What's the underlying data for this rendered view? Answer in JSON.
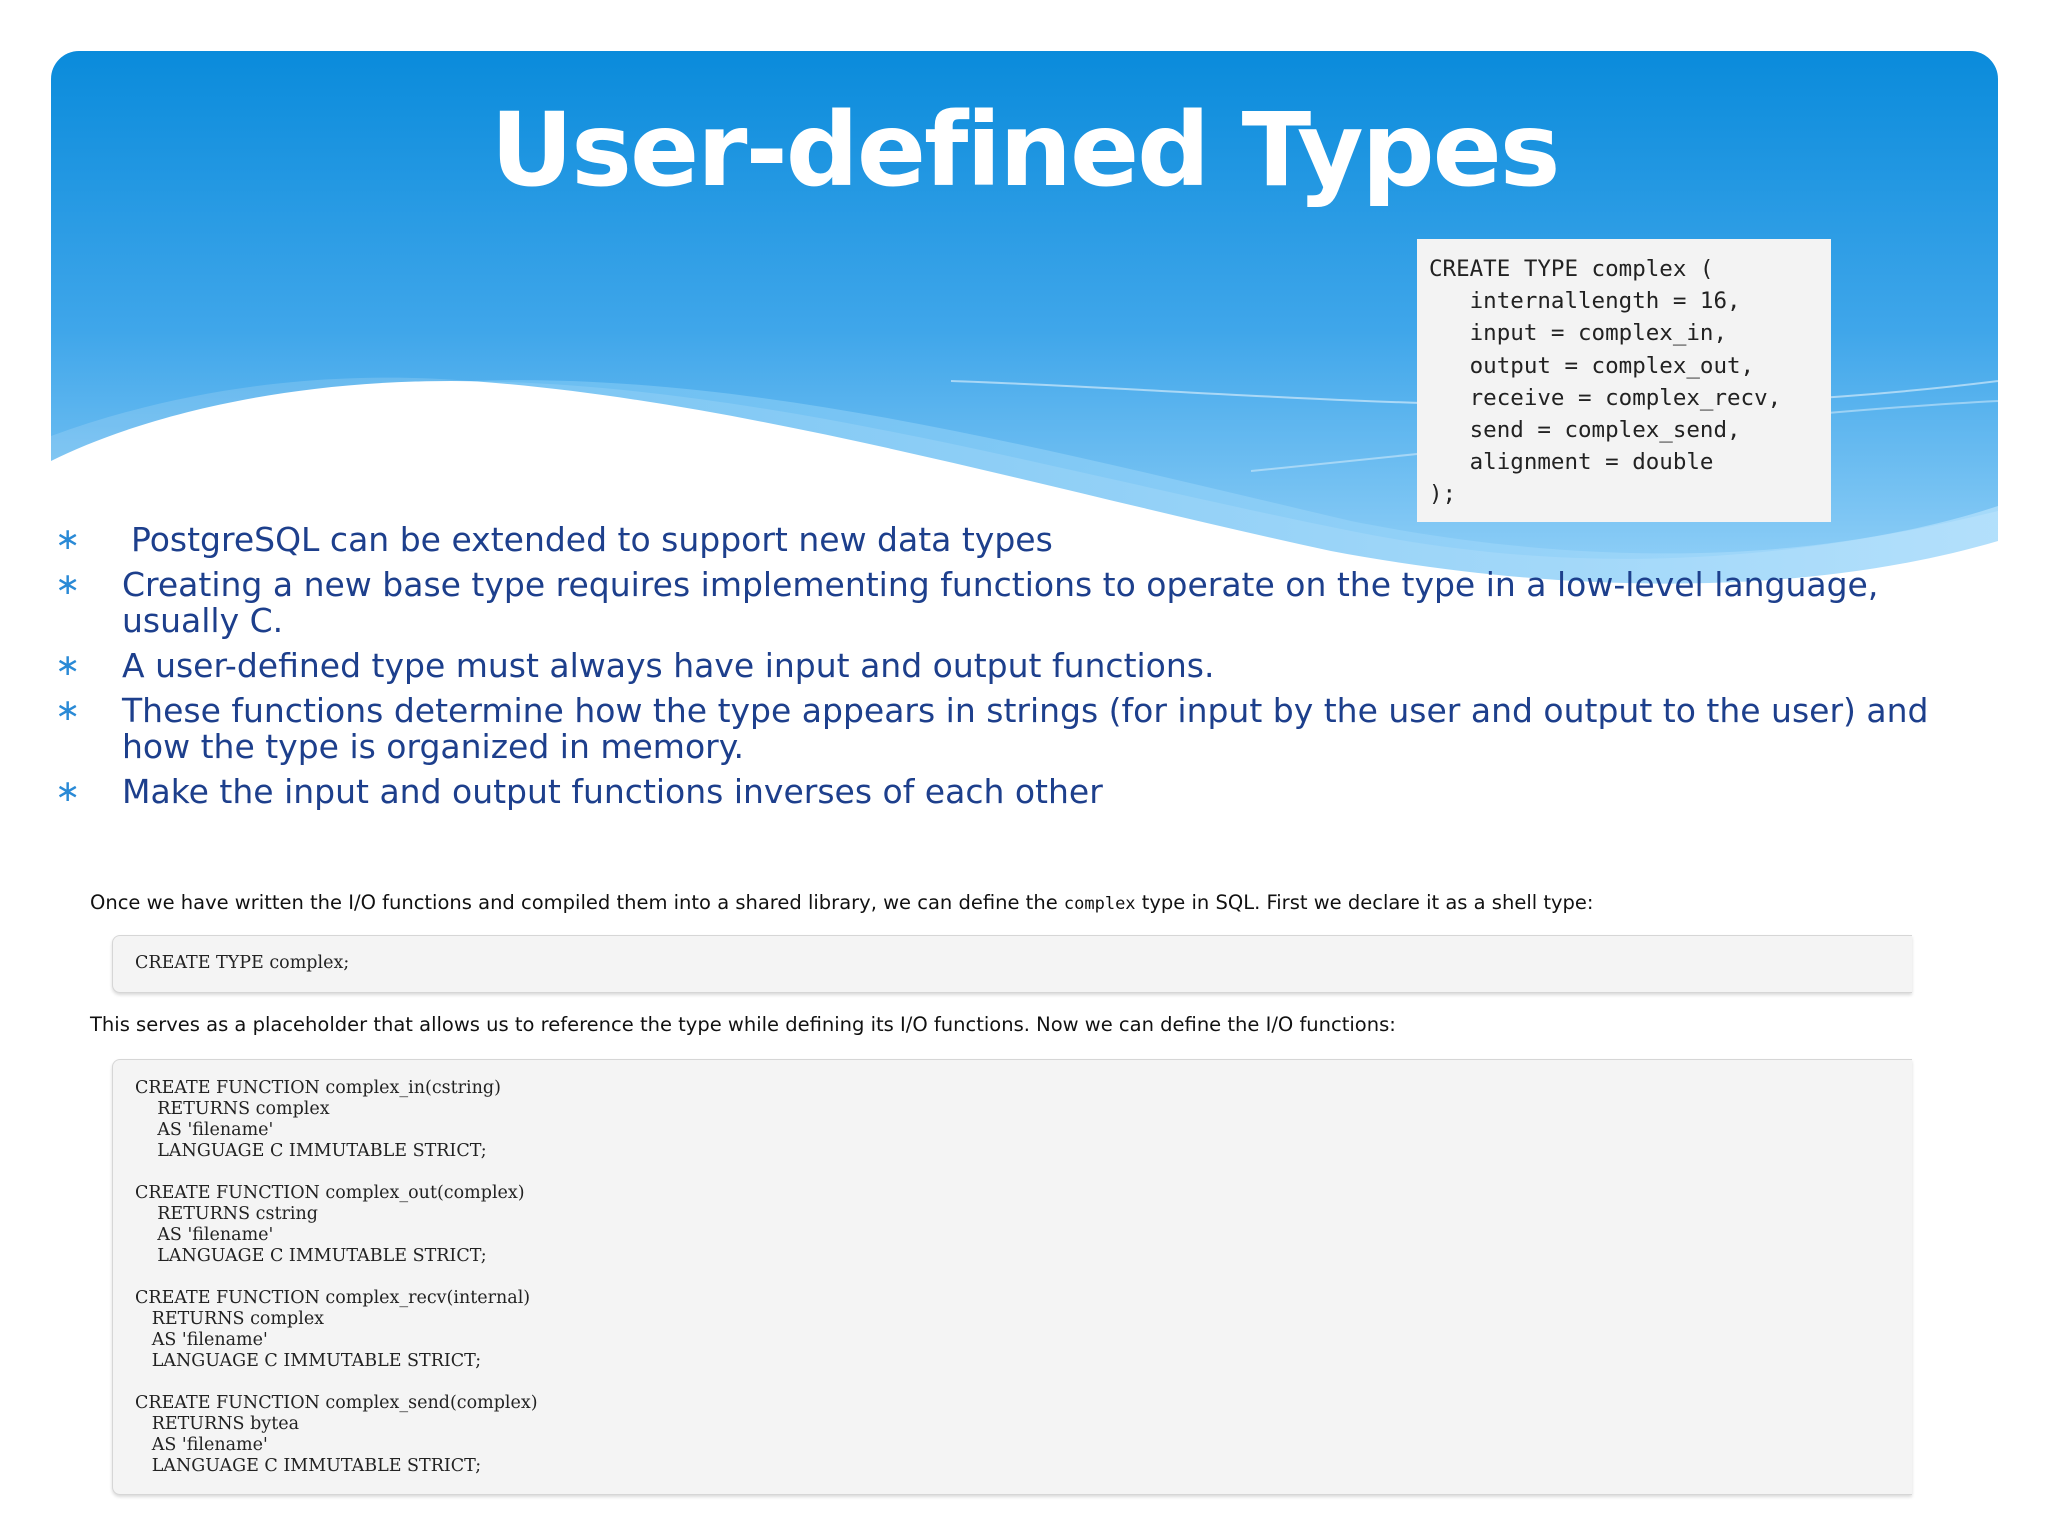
{
  "slide": {
    "title": "User-defined Types",
    "colors": {
      "title": "#ffffff",
      "bullet_text": "#1d3f8c",
      "bullet_marker": "#2a8ad6",
      "header_top": "#0b8fdc"
    }
  },
  "snippet": {
    "lines": [
      "CREATE TYPE complex (",
      "   internallength = 16,",
      "   input = complex_in,",
      "   output = complex_out,",
      "   receive = complex_recv,",
      "   send = complex_send,",
      "   alignment = double",
      ");"
    ]
  },
  "bullets": [
    {
      "marker": "∗",
      "text": "PostgreSQL can be extended to support new data types"
    },
    {
      "marker": "∗",
      "text": "Creating a new base type requires implementing functions to operate on the type in a low-level language, usually C."
    },
    {
      "marker": "∗",
      "text": "A user-defined type must always have input and output functions."
    },
    {
      "marker": "∗",
      "text": "These functions determine how the type appears in strings (for input by the user and output to the user) and how the type is organized in memory."
    },
    {
      "marker": "∗",
      "text": "Make the input and output functions inverses of each other"
    }
  ],
  "doc": {
    "para1_before": "Once we have written the I/O functions and compiled them into a shared library, we can define the ",
    "para1_code": "complex",
    "para1_after": " type in SQL. First we declare it as a shell type:",
    "code1": "CREATE TYPE complex;",
    "para2": "This serves as a placeholder that allows us to reference the type while defining its I/O functions. Now we can define the I/O functions:",
    "code2": "CREATE FUNCTION complex_in(cstring)\n    RETURNS complex\n    AS 'filename'\n    LANGUAGE C IMMUTABLE STRICT;\n\nCREATE FUNCTION complex_out(complex)\n    RETURNS cstring\n    AS 'filename'\n    LANGUAGE C IMMUTABLE STRICT;\n\nCREATE FUNCTION complex_recv(internal)\n   RETURNS complex\n   AS 'filename'\n   LANGUAGE C IMMUTABLE STRICT;\n\nCREATE FUNCTION complex_send(complex)\n   RETURNS bytea\n   AS 'filename'\n   LANGUAGE C IMMUTABLE STRICT;"
  }
}
